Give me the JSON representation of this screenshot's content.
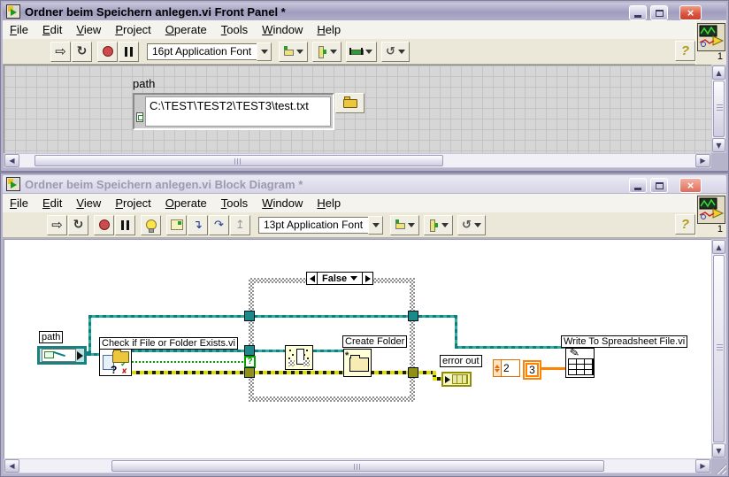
{
  "front_panel": {
    "title": "Ordner beim Speichern anlegen.vi Front Panel *",
    "menu": [
      "File",
      "Edit",
      "View",
      "Project",
      "Operate",
      "Tools",
      "Window",
      "Help"
    ],
    "toolbar": {
      "font_selector": "16pt Application Font",
      "help_label": "?"
    },
    "vi_badge": "1",
    "path_control": {
      "label": "path",
      "value": "C:\\TEST\\TEST2\\TEST3\\test.txt"
    }
  },
  "block_diagram": {
    "title": "Ordner beim Speichern anlegen.vi Block Diagram *",
    "menu": [
      "File",
      "Edit",
      "View",
      "Project",
      "Operate",
      "Tools",
      "Window",
      "Help"
    ],
    "toolbar": {
      "font_selector": "13pt Application Font",
      "help_label": "?"
    },
    "vi_badge": "1",
    "nodes": {
      "path_terminal_label": "path",
      "check_vi_label": "Check if File or Folder Exists.vi",
      "case_selector_value": "False",
      "case_selector_terminal": "?",
      "create_folder_label": "Create Folder",
      "error_out_label": "error out",
      "numeric_constant_1": "2",
      "numeric_constant_2": "3",
      "write_vi_label": "Write To Spreadsheet File.vi"
    }
  },
  "colors": {
    "path_wire": "#0c7f7f",
    "boolean_wire": "#00a000",
    "error_wire": "#dede00",
    "numeric_wire": "#ff8200",
    "active_title": "#9f9cbe",
    "inactive_title": "#d6d4e7",
    "close_button": "#d9523e"
  }
}
